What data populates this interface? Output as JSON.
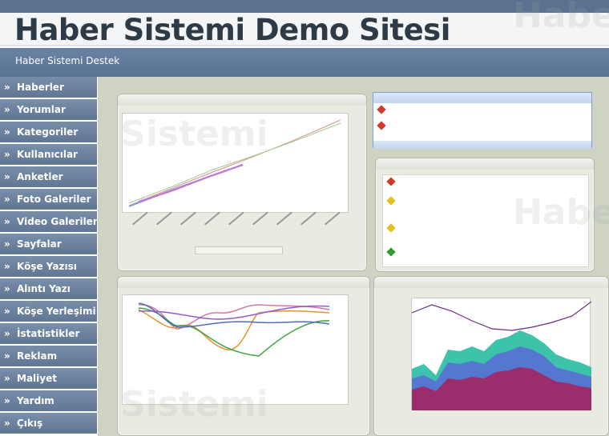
{
  "header": {
    "site_title": "Haber Sistemi Demo Sitesi",
    "sub_link": "Haber Sistemi Destek"
  },
  "sidebar": {
    "items": [
      {
        "label": "Haberler"
      },
      {
        "label": "Yorumlar"
      },
      {
        "label": "Kategoriler"
      },
      {
        "label": "Kullanıcılar"
      },
      {
        "label": "Anketler"
      },
      {
        "label": "Foto Galeriler"
      },
      {
        "label": "Video Galeriler"
      },
      {
        "label": "Sayfalar"
      },
      {
        "label": "Köşe Yazısı"
      },
      {
        "label": "Alıntı Yazı"
      },
      {
        "label": "Köşe Yerleşimi"
      },
      {
        "label": "İstatistikler"
      },
      {
        "label": "Reklam"
      },
      {
        "label": "Maliyet"
      },
      {
        "label": "Yardım"
      },
      {
        "label": "Çıkış"
      }
    ],
    "bullet": "»"
  },
  "watermark": {
    "text_a": "Haber",
    "text_b": "Sistemi"
  },
  "colors": {
    "sidebar_bg": "#6b819e",
    "topbar": "#5b7190",
    "main_bg": "#cfd3c4"
  }
}
